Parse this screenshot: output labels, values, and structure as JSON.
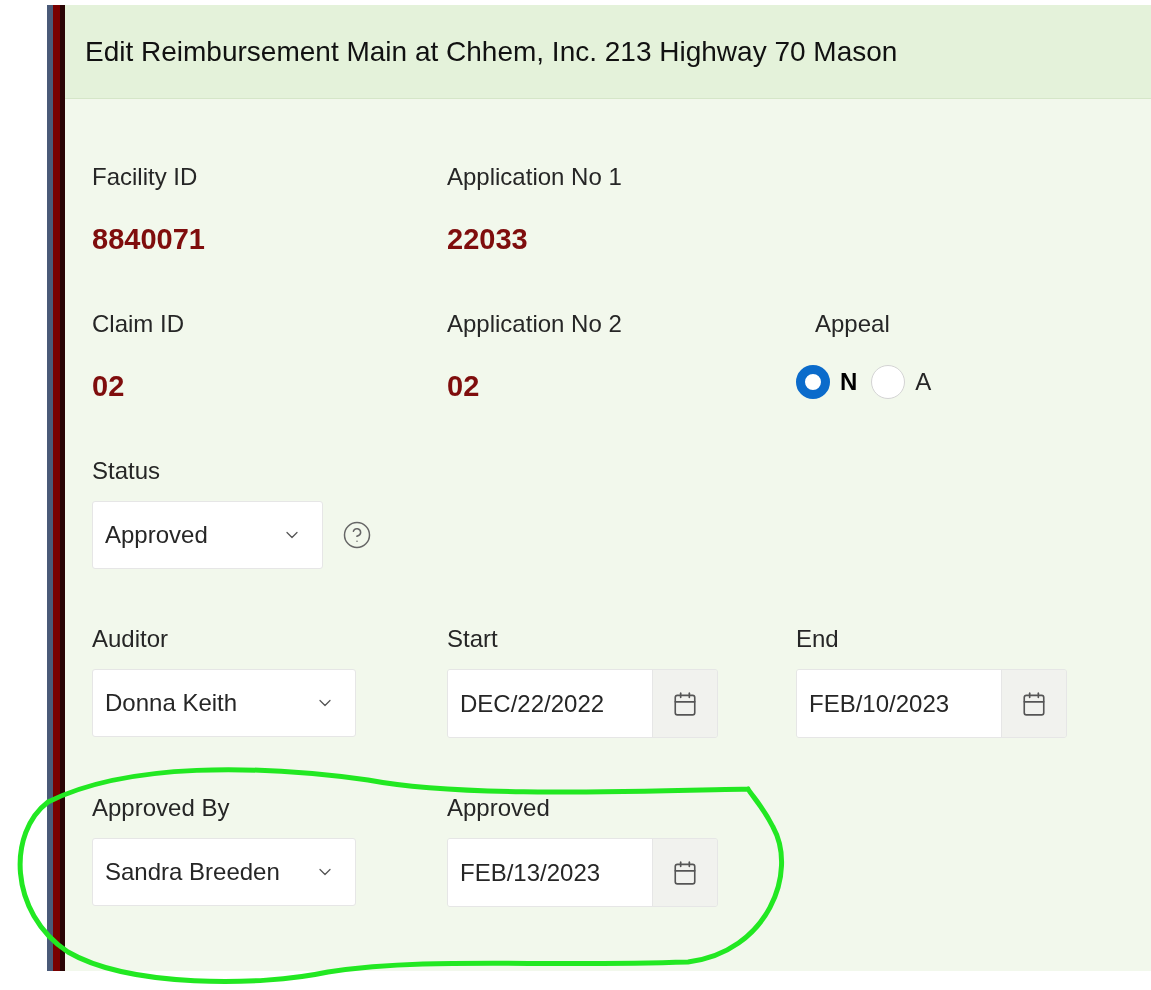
{
  "header": {
    "title": "Edit Reimbursement Main at Chhem, Inc. 213 Highway 70 Mason"
  },
  "rows": [
    [
      {
        "kind": "value",
        "label": "Facility ID",
        "value": "8840071"
      },
      {
        "kind": "value",
        "label": "Application No 1",
        "value": "22033"
      }
    ],
    [
      {
        "kind": "value",
        "label": "Claim ID",
        "value": "02"
      },
      {
        "kind": "value",
        "label": "Application No 2",
        "value": "02"
      },
      {
        "kind": "radio",
        "label": "Appeal",
        "options": [
          {
            "label": "N",
            "selected": true
          },
          {
            "label": "A",
            "selected": false
          }
        ]
      }
    ],
    [
      {
        "kind": "select",
        "label": "Status",
        "value": "Approved",
        "help": true
      }
    ],
    [
      {
        "kind": "select",
        "label": "Auditor",
        "value": "Donna Keith"
      },
      {
        "kind": "date",
        "label": "Start",
        "value": "DEC/22/2022"
      },
      {
        "kind": "date",
        "label": "End",
        "value": "FEB/10/2023"
      }
    ],
    [
      {
        "kind": "select",
        "label": "Approved By",
        "value": "Sandra Breeden"
      },
      {
        "kind": "date",
        "label": "Approved",
        "value": "FEB/13/2023"
      }
    ]
  ],
  "annotation": {
    "kind": "circle",
    "color": "#22e822"
  }
}
